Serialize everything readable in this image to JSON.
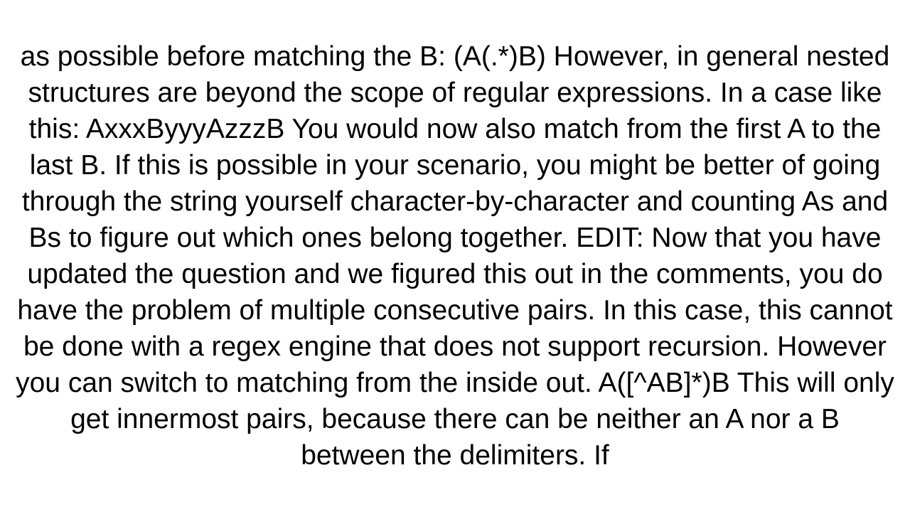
{
  "document": {
    "text": "as possible before matching the B: (A(.*)B)  However, in general nested structures are beyond the scope of regular expressions. In a case like this: AxxxByyyAzzzB  You would now also match from the first A to the last B. If this is possible in your scenario, you might be better of going through the string yourself character-by-character and counting As and Bs to figure out which ones belong together. EDIT: Now that you have updated the question and we figured this out in the comments, you do have the problem of multiple consecutive pairs. In this case, this cannot be done with a regex engine that does not support recursion. However you can switch to matching from the inside out. A([^AB]*)B  This will only get innermost pairs, because there can be neither an A nor a B between the delimiters. If"
  }
}
